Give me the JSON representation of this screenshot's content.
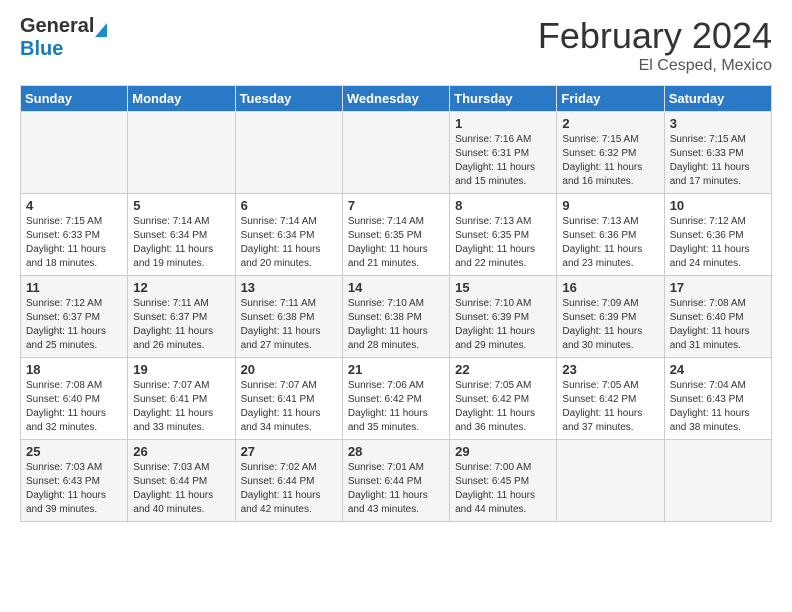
{
  "header": {
    "logo_general": "General",
    "logo_blue": "Blue",
    "month_title": "February 2024",
    "location": "El Cesped, Mexico"
  },
  "days_of_week": [
    "Sunday",
    "Monday",
    "Tuesday",
    "Wednesday",
    "Thursday",
    "Friday",
    "Saturday"
  ],
  "weeks": [
    [
      {
        "day": "",
        "info": ""
      },
      {
        "day": "",
        "info": ""
      },
      {
        "day": "",
        "info": ""
      },
      {
        "day": "",
        "info": ""
      },
      {
        "day": "1",
        "info": "Sunrise: 7:16 AM\nSunset: 6:31 PM\nDaylight: 11 hours and 15 minutes."
      },
      {
        "day": "2",
        "info": "Sunrise: 7:15 AM\nSunset: 6:32 PM\nDaylight: 11 hours and 16 minutes."
      },
      {
        "day": "3",
        "info": "Sunrise: 7:15 AM\nSunset: 6:33 PM\nDaylight: 11 hours and 17 minutes."
      }
    ],
    [
      {
        "day": "4",
        "info": "Sunrise: 7:15 AM\nSunset: 6:33 PM\nDaylight: 11 hours and 18 minutes."
      },
      {
        "day": "5",
        "info": "Sunrise: 7:14 AM\nSunset: 6:34 PM\nDaylight: 11 hours and 19 minutes."
      },
      {
        "day": "6",
        "info": "Sunrise: 7:14 AM\nSunset: 6:34 PM\nDaylight: 11 hours and 20 minutes."
      },
      {
        "day": "7",
        "info": "Sunrise: 7:14 AM\nSunset: 6:35 PM\nDaylight: 11 hours and 21 minutes."
      },
      {
        "day": "8",
        "info": "Sunrise: 7:13 AM\nSunset: 6:35 PM\nDaylight: 11 hours and 22 minutes."
      },
      {
        "day": "9",
        "info": "Sunrise: 7:13 AM\nSunset: 6:36 PM\nDaylight: 11 hours and 23 minutes."
      },
      {
        "day": "10",
        "info": "Sunrise: 7:12 AM\nSunset: 6:36 PM\nDaylight: 11 hours and 24 minutes."
      }
    ],
    [
      {
        "day": "11",
        "info": "Sunrise: 7:12 AM\nSunset: 6:37 PM\nDaylight: 11 hours and 25 minutes."
      },
      {
        "day": "12",
        "info": "Sunrise: 7:11 AM\nSunset: 6:37 PM\nDaylight: 11 hours and 26 minutes."
      },
      {
        "day": "13",
        "info": "Sunrise: 7:11 AM\nSunset: 6:38 PM\nDaylight: 11 hours and 27 minutes."
      },
      {
        "day": "14",
        "info": "Sunrise: 7:10 AM\nSunset: 6:38 PM\nDaylight: 11 hours and 28 minutes."
      },
      {
        "day": "15",
        "info": "Sunrise: 7:10 AM\nSunset: 6:39 PM\nDaylight: 11 hours and 29 minutes."
      },
      {
        "day": "16",
        "info": "Sunrise: 7:09 AM\nSunset: 6:39 PM\nDaylight: 11 hours and 30 minutes."
      },
      {
        "day": "17",
        "info": "Sunrise: 7:08 AM\nSunset: 6:40 PM\nDaylight: 11 hours and 31 minutes."
      }
    ],
    [
      {
        "day": "18",
        "info": "Sunrise: 7:08 AM\nSunset: 6:40 PM\nDaylight: 11 hours and 32 minutes."
      },
      {
        "day": "19",
        "info": "Sunrise: 7:07 AM\nSunset: 6:41 PM\nDaylight: 11 hours and 33 minutes."
      },
      {
        "day": "20",
        "info": "Sunrise: 7:07 AM\nSunset: 6:41 PM\nDaylight: 11 hours and 34 minutes."
      },
      {
        "day": "21",
        "info": "Sunrise: 7:06 AM\nSunset: 6:42 PM\nDaylight: 11 hours and 35 minutes."
      },
      {
        "day": "22",
        "info": "Sunrise: 7:05 AM\nSunset: 6:42 PM\nDaylight: 11 hours and 36 minutes."
      },
      {
        "day": "23",
        "info": "Sunrise: 7:05 AM\nSunset: 6:42 PM\nDaylight: 11 hours and 37 minutes."
      },
      {
        "day": "24",
        "info": "Sunrise: 7:04 AM\nSunset: 6:43 PM\nDaylight: 11 hours and 38 minutes."
      }
    ],
    [
      {
        "day": "25",
        "info": "Sunrise: 7:03 AM\nSunset: 6:43 PM\nDaylight: 11 hours and 39 minutes."
      },
      {
        "day": "26",
        "info": "Sunrise: 7:03 AM\nSunset: 6:44 PM\nDaylight: 11 hours and 40 minutes."
      },
      {
        "day": "27",
        "info": "Sunrise: 7:02 AM\nSunset: 6:44 PM\nDaylight: 11 hours and 42 minutes."
      },
      {
        "day": "28",
        "info": "Sunrise: 7:01 AM\nSunset: 6:44 PM\nDaylight: 11 hours and 43 minutes."
      },
      {
        "day": "29",
        "info": "Sunrise: 7:00 AM\nSunset: 6:45 PM\nDaylight: 11 hours and 44 minutes."
      },
      {
        "day": "",
        "info": ""
      },
      {
        "day": "",
        "info": ""
      }
    ]
  ]
}
